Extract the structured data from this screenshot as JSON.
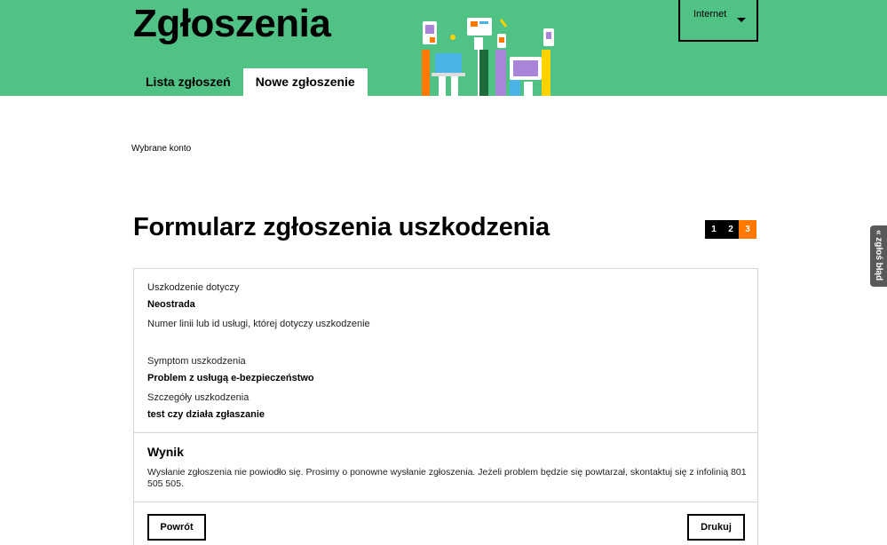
{
  "header": {
    "title": "Zgłoszenia",
    "tabs": [
      {
        "label": "Lista zgłoszeń",
        "active": false
      },
      {
        "label": "Nowe zgłoszenie",
        "active": true
      }
    ],
    "account_select": {
      "value": "Internet"
    },
    "colors": {
      "header_bg": "#50c285",
      "accent": "#ff7900"
    }
  },
  "main": {
    "selected_account_label": "Wybrane konto",
    "form_title": "Formularz zgłoszenia uszkodzenia",
    "steps": [
      {
        "label": "1",
        "active": false
      },
      {
        "label": "2",
        "active": false
      },
      {
        "label": "3",
        "active": true
      }
    ],
    "details": {
      "fields": [
        {
          "label": "Uszkodzenie dotyczy",
          "value": "Neostrada"
        },
        {
          "label": "Numer linii lub id usługi, której dotyczy uszkodzenie",
          "value": ""
        },
        {
          "label": "Symptom uszkodzenia",
          "value": "Problem z usługą e-bezpieczeństwo"
        },
        {
          "label": "Szczegóły uszkodzenia",
          "value": "test czy działa zgłaszanie"
        }
      ]
    },
    "result": {
      "title": "Wynik",
      "message": "Wysłanie zgłoszenia nie powiodło się. Prosimy o ponowne wysłanie zgłoszenia. Jeżeli problem będzie się powtarzał, skontaktuj się z infolinią 801 505 505."
    },
    "buttons": {
      "back": "Powrót",
      "print": "Drukuj"
    }
  },
  "side_tab": {
    "label": "« zgłoś błąd"
  }
}
